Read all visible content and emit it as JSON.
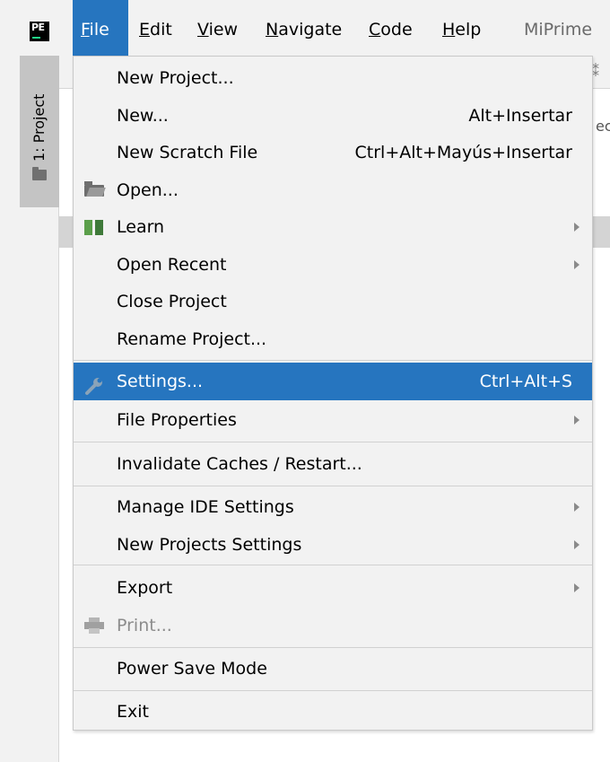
{
  "app": {
    "logo_text": "PE",
    "window_title": "MiPrime"
  },
  "menubar": [
    {
      "label": "File",
      "u": "F",
      "rest": "ile",
      "active": true
    },
    {
      "label": "Edit",
      "u": "E",
      "rest": "dit"
    },
    {
      "label": "View",
      "u": "V",
      "rest": "iew"
    },
    {
      "label": "Navigate",
      "u": "N",
      "rest": "avigate"
    },
    {
      "label": "Code",
      "u": "C",
      "rest": "ode"
    },
    {
      "label": "Help",
      "u": "H",
      "rest": "elp"
    }
  ],
  "toolwindow": {
    "project_tab": "1: Project"
  },
  "background": {
    "pin": "⁑",
    "fragment": "ec"
  },
  "file_menu": {
    "new_project": "New Project...",
    "new": "New...",
    "new_shortcut": "Alt+Insertar",
    "new_scratch": "New Scratch File",
    "new_scratch_shortcut": "Ctrl+Alt+Mayús+Insertar",
    "open": "Open...",
    "learn": "Learn",
    "open_recent": "Open Recent",
    "close_project": "Close Project",
    "rename_project": "Rename Project...",
    "settings": "Settings...",
    "settings_shortcut": "Ctrl+Alt+S",
    "file_properties": "File Properties",
    "invalidate_caches": "Invalidate Caches / Restart...",
    "manage_ide_settings": "Manage IDE Settings",
    "new_projects_settings": "New Projects Settings",
    "export": "Export",
    "print": "Print...",
    "power_save_mode": "Power Save Mode",
    "exit": "Exit"
  },
  "colors": {
    "accent": "#2675bf",
    "menu_bg": "#f2f2f2",
    "disabled": "#8c8c8c"
  }
}
